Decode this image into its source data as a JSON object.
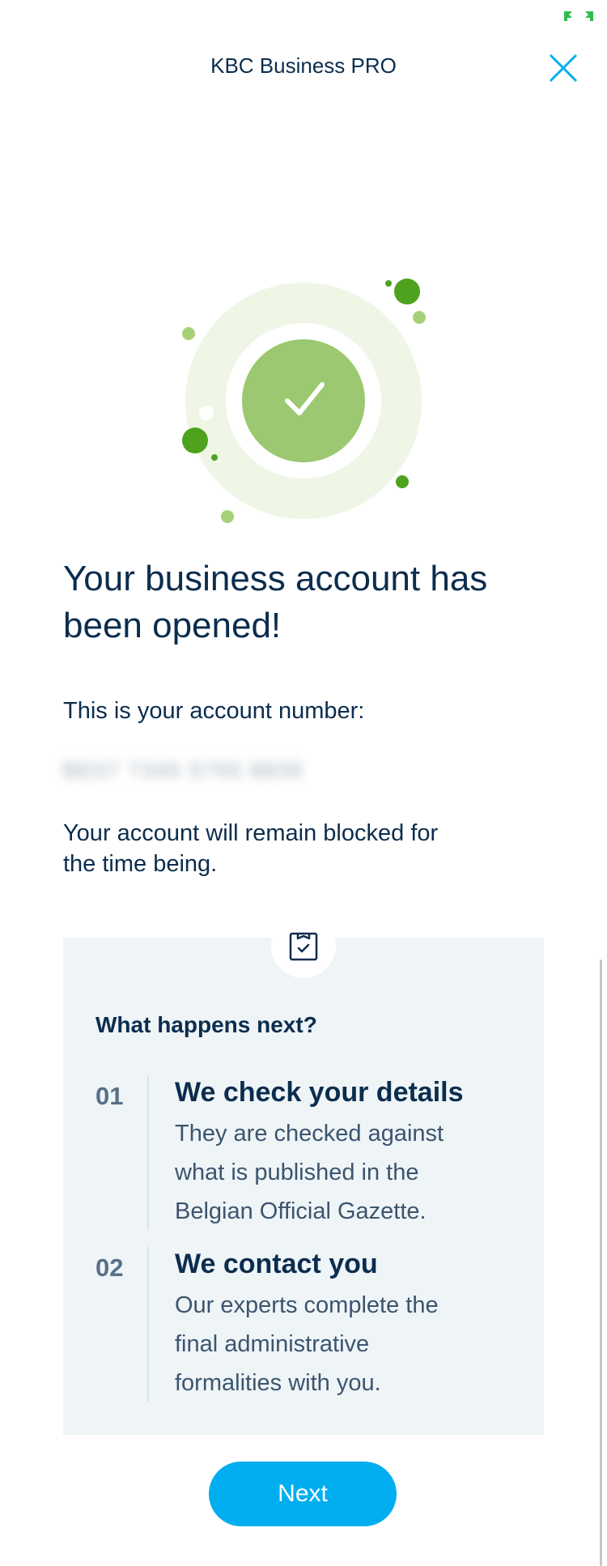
{
  "status_indicator": {
    "icon": "fullscreen-icon",
    "color": "#2dbd4e"
  },
  "header": {
    "title": "KBC Business PRO",
    "close_icon": "close-icon"
  },
  "hero": {
    "icon": "checkmark-icon",
    "colors": {
      "ring": "#eff6e6",
      "circle": "#9bc870",
      "dots_dark": "#4ea21e",
      "dots_light": "#a7d179"
    }
  },
  "main": {
    "title_line1": "Your business account has",
    "title_line2": "been opened!",
    "account_label": "This is your account number:",
    "account_number_masked": "BE07 7345 5755 8839",
    "blocked_line1": "Your account will remain blocked for",
    "blocked_line2": "the time being."
  },
  "info_card": {
    "icon": "clipboard-check-icon",
    "heading": "What happens next?",
    "steps": [
      {
        "num": "01",
        "title": "We check your details",
        "lines": [
          "They are checked against",
          "what is published in the",
          "Belgian Official Gazette."
        ]
      },
      {
        "num": "02",
        "title": "We contact you",
        "lines": [
          "Our experts complete the",
          "final administrative",
          "formalities with you."
        ]
      }
    ]
  },
  "footer": {
    "next_label": "Next"
  },
  "colors": {
    "primary": "#00aeef",
    "text": "#0b2d4e",
    "card_bg": "#eff4f7"
  }
}
